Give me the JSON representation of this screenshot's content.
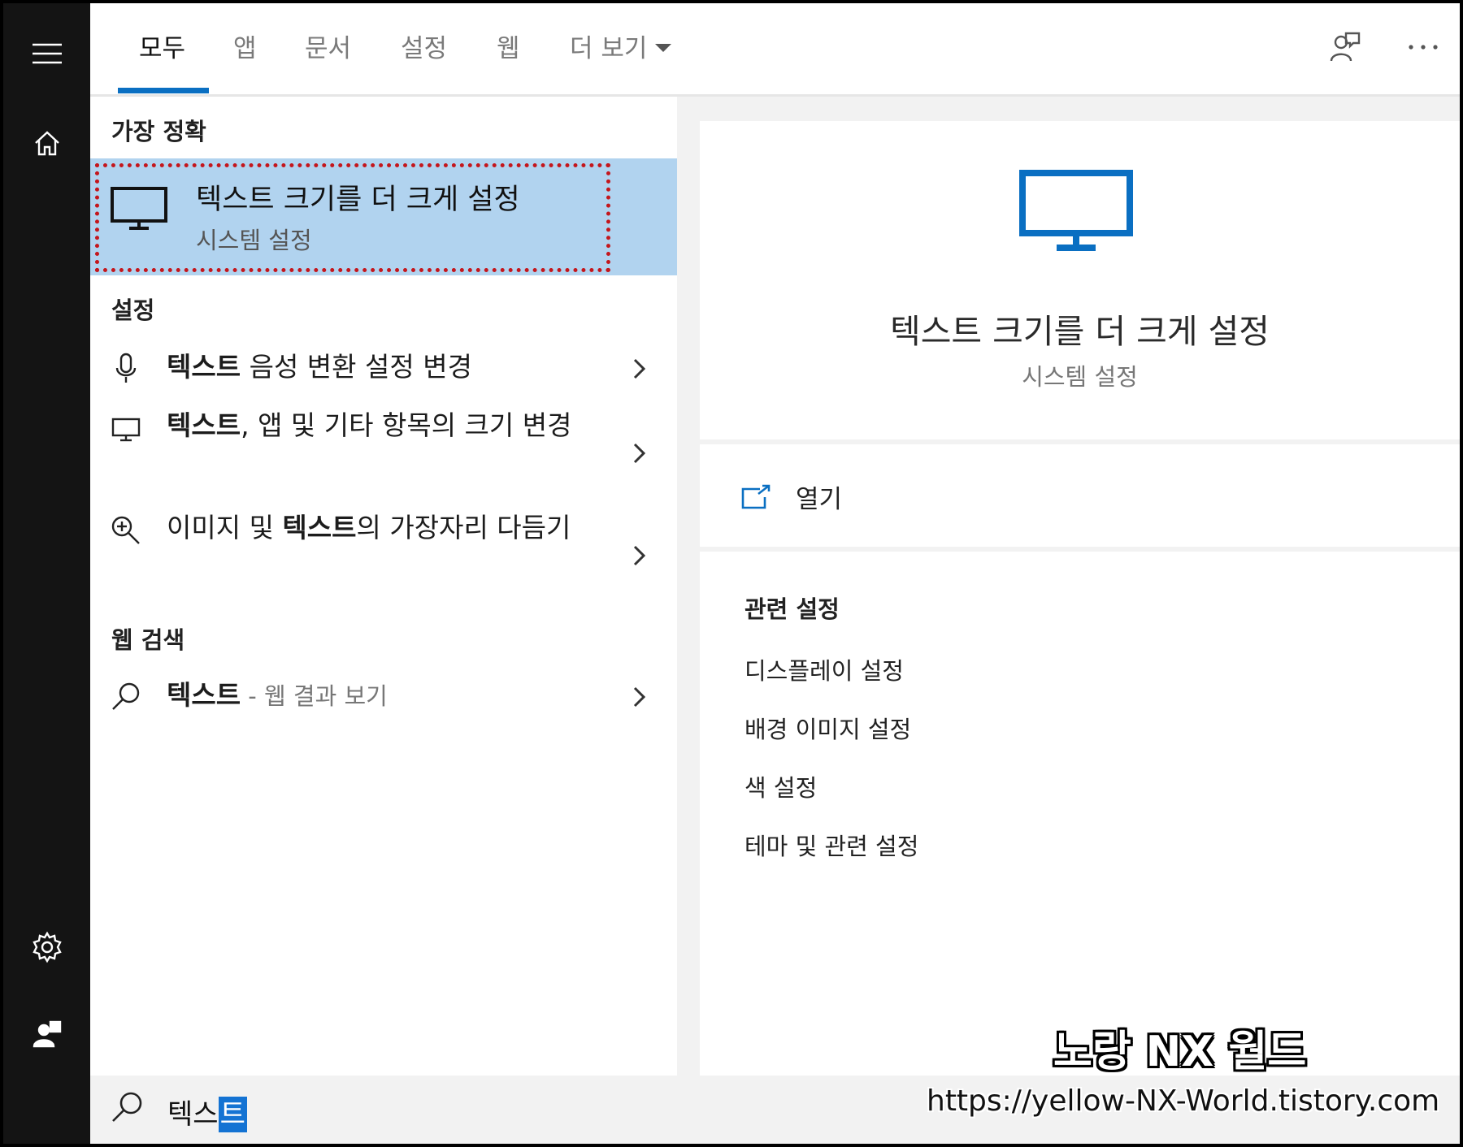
{
  "tabs": [
    {
      "label": "모두"
    },
    {
      "label": "앱"
    },
    {
      "label": "문서"
    },
    {
      "label": "설정"
    },
    {
      "label": "웹"
    },
    {
      "label": "더 보기"
    }
  ],
  "active_tab": "모두",
  "left": {
    "best_match_heading": "가장 정확",
    "best_match": {
      "title": "텍스트 크기를 더 크게 설정",
      "subtitle": "시스템 설정",
      "icon": "monitor-icon"
    },
    "settings_heading": "설정",
    "settings_items": [
      {
        "icon": "microphone-icon",
        "bold": "텍스트",
        "rest": " 음성 변환 설정 변경"
      },
      {
        "icon": "monitor-icon",
        "bold": "텍스트",
        "rest": ", 앱 및 기타 항목의 크기 변경"
      },
      {
        "icon": "magnifier-plus-icon",
        "pre": "이미지 및 ",
        "bold": "텍스트",
        "rest": "의 가장자리 다듬기"
      }
    ],
    "web_heading": "웹 검색",
    "web_item": {
      "icon": "search-icon",
      "bold": "텍스트",
      "hint": " - 웹 결과 보기"
    }
  },
  "preview": {
    "title": "텍스트 크기를 더 크게 설정",
    "subtitle": "시스템 설정",
    "open_label": "열기",
    "related_heading": "관련 설정",
    "related": [
      "디스플레이 설정",
      "배경 이미지 설정",
      "색 설정",
      "테마 및 관련 설정"
    ]
  },
  "search": {
    "typed": "텍스",
    "selected": "트"
  },
  "watermark": {
    "line1": "노랑 NX 월드",
    "line2": "https://yellow-NX-World.tistory.com"
  },
  "colors": {
    "accent": "#0a6fc2",
    "highlight": "#b1d3ef",
    "outline": "#c4161c"
  }
}
